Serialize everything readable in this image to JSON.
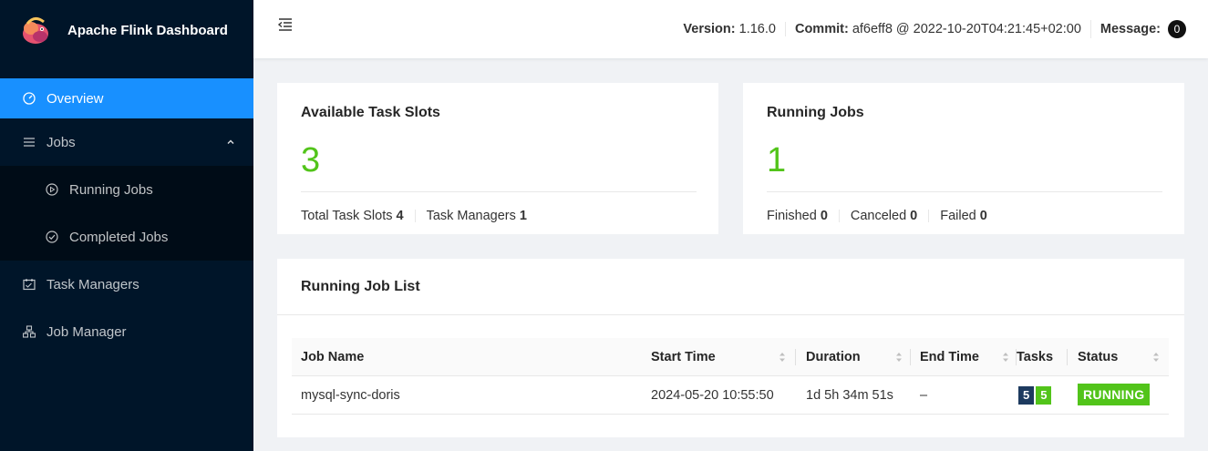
{
  "app": {
    "title": "Apache Flink Dashboard"
  },
  "sidebar": {
    "items": [
      {
        "label": "Overview",
        "icon": "dashboard-icon",
        "selected": true
      },
      {
        "label": "Jobs",
        "icon": "list-icon",
        "expanded": true
      },
      {
        "label": "Running Jobs",
        "icon": "play-circle-icon"
      },
      {
        "label": "Completed Jobs",
        "icon": "check-circle-icon"
      },
      {
        "label": "Task Managers",
        "icon": "schedule-icon"
      },
      {
        "label": "Job Manager",
        "icon": "cluster-icon"
      }
    ]
  },
  "header": {
    "version_label": "Version:",
    "version": "1.16.0",
    "commit_label": "Commit:",
    "commit": "af6eff8 @ 2022-10-20T04:21:45+02:00",
    "message_label": "Message:",
    "message_count": "0"
  },
  "task_slots": {
    "title": "Available Task Slots",
    "available": "3",
    "total_label": "Total Task Slots",
    "total": "4",
    "tm_label": "Task Managers",
    "tm": "1"
  },
  "running_jobs": {
    "title": "Running Jobs",
    "count": "1",
    "finished_label": "Finished",
    "finished": "0",
    "canceled_label": "Canceled",
    "canceled": "0",
    "failed_label": "Failed",
    "failed": "0"
  },
  "job_list": {
    "title": "Running Job List",
    "columns": [
      "Job Name",
      "Start Time",
      "Duration",
      "End Time",
      "Tasks",
      "Status"
    ],
    "rows": [
      {
        "name": "mysql-sync-doris",
        "start": "2024-05-20 10:55:50",
        "duration": "1d 5h 34m 51s",
        "end": "–",
        "tasks_total": "5",
        "tasks_running": "5",
        "status": "RUNNING"
      }
    ]
  },
  "colors": {
    "sidebar_bg": "#001529",
    "accent": "#1890ff",
    "success": "#52c41a",
    "total_badge": "#1d3a5f"
  }
}
